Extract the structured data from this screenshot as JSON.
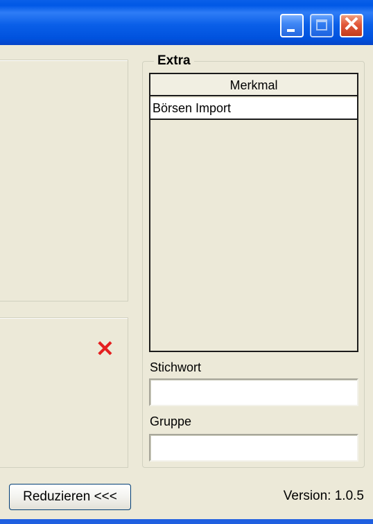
{
  "window": {
    "controls": {
      "minimize": "minimize-icon",
      "maximize": "maximize-icon",
      "close": "close-icon"
    }
  },
  "left_panel": {
    "delete_icon": "red-x-icon",
    "delete_color": "#e41f1f"
  },
  "extra": {
    "legend": "Extra",
    "list": {
      "column_header": "Merkmal",
      "rows": [
        "Börsen Import"
      ]
    },
    "stichwort_label": "Stichwort",
    "stichwort_value": "",
    "gruppe_label": "Gruppe",
    "gruppe_value": ""
  },
  "footer": {
    "reduce_button": "Reduzieren <<<",
    "version": "Version: 1.0.5"
  },
  "colors": {
    "titlebar": "#0a5fe8",
    "background": "#ece9d8"
  }
}
